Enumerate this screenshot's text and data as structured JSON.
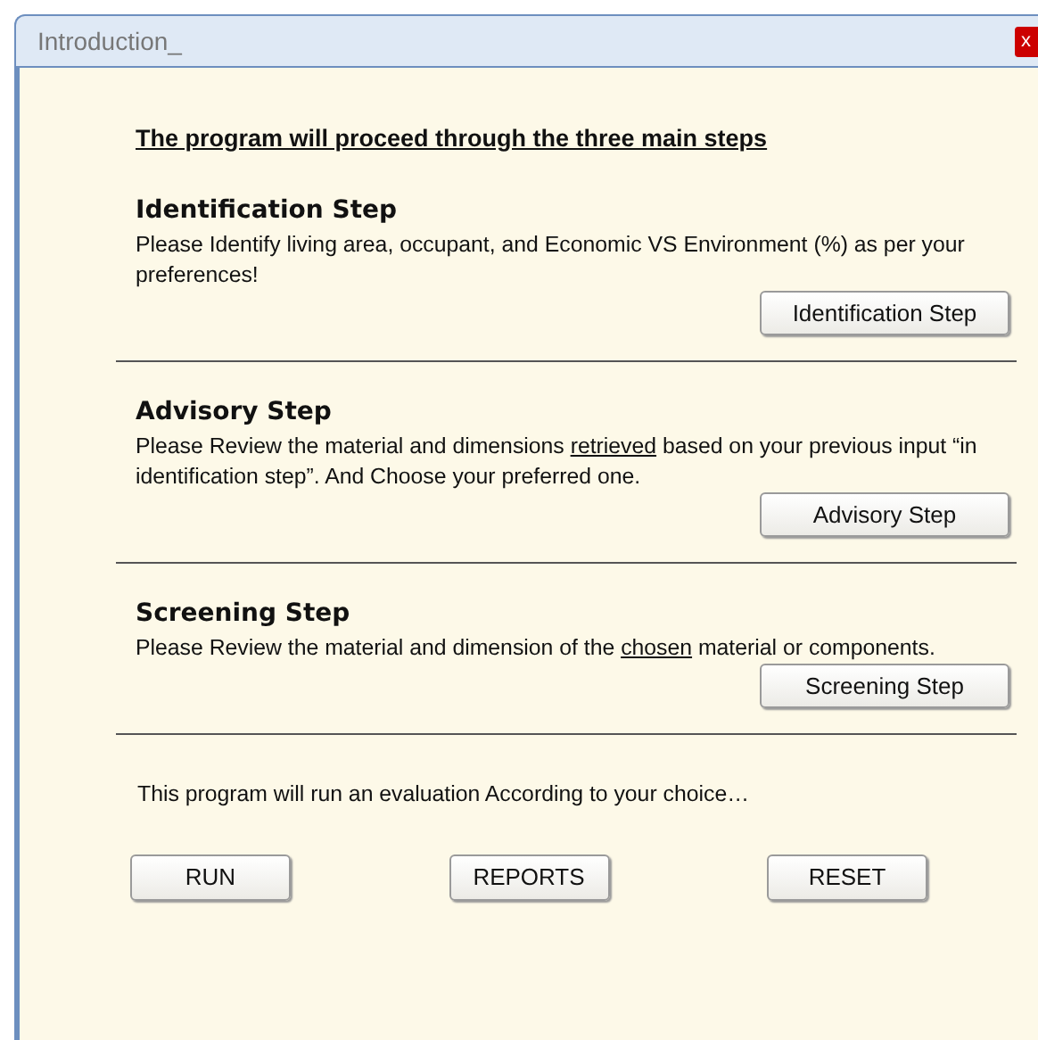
{
  "window": {
    "title": "Introduction_",
    "close": "x"
  },
  "heading": "The program will proceed through the three main steps",
  "steps": [
    {
      "title": "Identification Step",
      "description": [
        {
          "text": "Please Identify living area, occupant, and Economic VS Environment (%) as per your preferences!",
          "underline": false
        }
      ],
      "button": "Identification Step"
    },
    {
      "title": "Advisory Step",
      "description": [
        {
          "text": "Please Review the material and dimensions ",
          "underline": false
        },
        {
          "text": "retrieved",
          "underline": true
        },
        {
          "text": " based on your previous input “in identification step”. And Choose your preferred one.",
          "underline": false
        }
      ],
      "button": "Advisory Step"
    },
    {
      "title": "Screening Step",
      "description": [
        {
          "text": "Please Review the material and dimension of the ",
          "underline": false
        },
        {
          "text": "chosen",
          "underline": true
        },
        {
          "text": " material or components.",
          "underline": false
        }
      ],
      "button": "Screening Step"
    }
  ],
  "footer_text": "This program will run an evaluation According to your choice…",
  "buttons": [
    "RUN",
    "REPORTS",
    "RESET"
  ]
}
